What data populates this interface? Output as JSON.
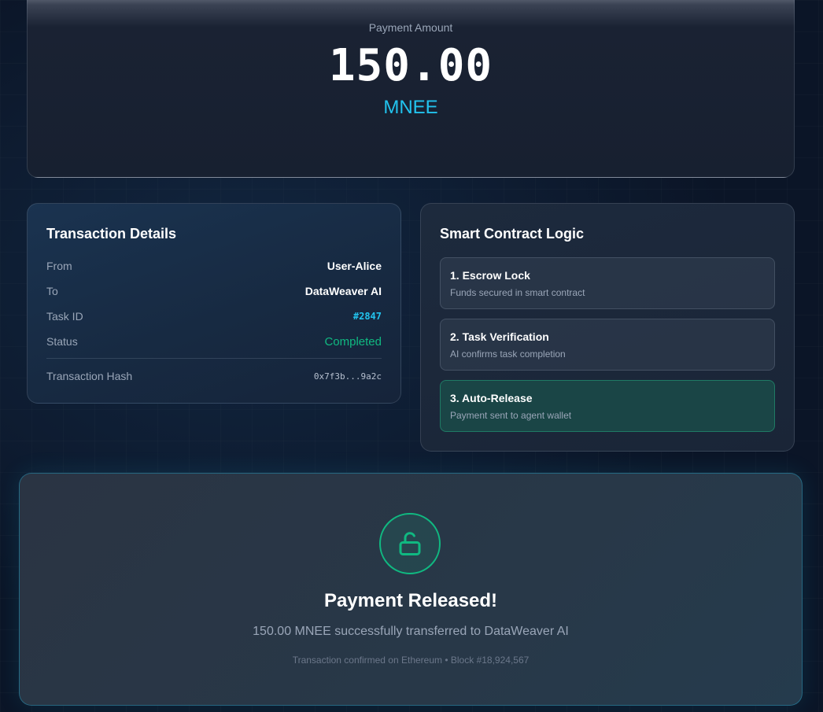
{
  "amount": {
    "label": "Payment Amount",
    "value": "150.00",
    "currency": "MNEE"
  },
  "details": {
    "title": "Transaction Details",
    "rows": [
      {
        "key": "From",
        "value": "User-Alice"
      },
      {
        "key": "To",
        "value": "DataWeaver AI"
      },
      {
        "key": "Task ID",
        "value": "#2847"
      },
      {
        "key": "Status",
        "value": "Completed"
      }
    ],
    "hash_label": "Transaction Hash",
    "hash_value": "0x7f3b...9a2c"
  },
  "contract": {
    "title": "Smart Contract Logic",
    "steps": [
      {
        "title": "1. Escrow Lock",
        "desc": "Funds secured in smart contract"
      },
      {
        "title": "2. Task Verification",
        "desc": "AI confirms task completion"
      },
      {
        "title": "3. Auto-Release",
        "desc": "Payment sent to agent wallet"
      }
    ]
  },
  "released": {
    "icon": "unlock-icon",
    "title": "Payment Released!",
    "message": "150.00 MNEE successfully transferred to DataWeaver AI",
    "meta": "Transaction confirmed on Ethereum • Block #18,924,567"
  },
  "colors": {
    "accent": "#22c3ee",
    "success": "#10b981",
    "background": "#0b1527"
  }
}
